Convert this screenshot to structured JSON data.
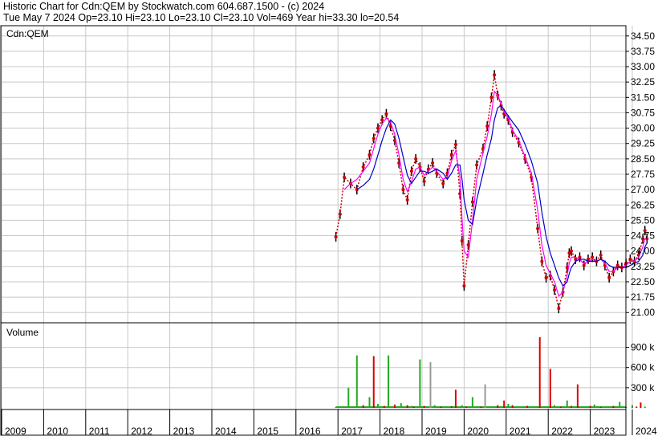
{
  "header": {
    "line1": "Historic Chart for Cdn:QEM by Stockwatch.com 604.687.1500 - (c) 2024",
    "line2": "Tue May  7 2024  Op=23.10  Hi=23.10  Lo=23.10  Cl=23.10  Vol=469  Year hi=33.30  lo=20.54"
  },
  "colors": {
    "grid": "#c8c8c8",
    "price": "#cc0000",
    "bar": "#000000",
    "ma_short": "#ff00ff",
    "ma_long": "#0000cc",
    "vol_up": "#22aa22",
    "vol_down": "#dd0000",
    "vol_flat": "#999999"
  },
  "chart_data": [
    {
      "type": "line",
      "title": "Cdn:QEM",
      "y_ticks": [
        "34.50",
        "33.75",
        "33.00",
        "32.25",
        "31.50",
        "30.75",
        "30.00",
        "29.25",
        "28.50",
        "27.75",
        "27.00",
        "26.25",
        "25.50",
        "24.75",
        "24.00",
        "23.25",
        "22.50",
        "21.75",
        "21.00"
      ],
      "ylim": [
        20.5,
        35.0
      ],
      "x_ticks": [
        "2009",
        "2010",
        "2011",
        "2012",
        "2013",
        "2014",
        "2015",
        "2016",
        "2017",
        "2018",
        "2019",
        "2020",
        "2021",
        "2022",
        "2023",
        "2024"
      ],
      "x": [
        2016.95,
        2017.05,
        2017.15,
        2017.3,
        2017.45,
        2017.6,
        2017.75,
        2017.85,
        2017.95,
        2018.05,
        2018.15,
        2018.25,
        2018.35,
        2018.45,
        2018.55,
        2018.65,
        2018.75,
        2018.85,
        2018.95,
        2019.05,
        2019.15,
        2019.25,
        2019.35,
        2019.5,
        2019.6,
        2019.7,
        2019.8,
        2019.9,
        2019.95,
        2020.0,
        2020.1,
        2020.2,
        2020.3,
        2020.45,
        2020.55,
        2020.65,
        2020.72,
        2020.8,
        2020.88,
        2020.95,
        2021.05,
        2021.15,
        2021.3,
        2021.45,
        2021.6,
        2021.75,
        2021.85,
        2021.95,
        2022.05,
        2022.15,
        2022.25,
        2022.35,
        2022.45,
        2022.5,
        2022.55,
        2022.65,
        2022.75,
        2022.85,
        2022.95,
        2023.05,
        2023.15,
        2023.25,
        2023.35,
        2023.45,
        2023.55,
        2023.65,
        2023.75,
        2023.85,
        2023.95,
        2024.05,
        2024.15,
        2024.25,
        2024.3,
        2024.35
      ],
      "series": [
        {
          "values": [
            24.7,
            25.8,
            27.6,
            27.3,
            27.0,
            28.1,
            28.7,
            29.5,
            30.0,
            30.4,
            30.7,
            30.1,
            29.4,
            28.3,
            27.0,
            26.5,
            27.9,
            28.5,
            28.1,
            27.4,
            28.0,
            28.3,
            27.8,
            27.3,
            27.8,
            28.7,
            29.2,
            26.8,
            24.5,
            22.3,
            24.3,
            26.4,
            28.2,
            29.0,
            30.1,
            31.5,
            32.6,
            31.6,
            31.1,
            30.7,
            30.4,
            29.8,
            29.3,
            28.5,
            27.6,
            25.1,
            23.5,
            22.7,
            22.8,
            22.1,
            21.2,
            22.0,
            23.2,
            23.9,
            24.0,
            23.6,
            23.7,
            23.3,
            23.6,
            23.7,
            23.5,
            23.8,
            23.3,
            22.7,
            23.0,
            23.3,
            23.2,
            23.4,
            23.6,
            23.5,
            23.8,
            24.6,
            25.0,
            24.6
          ]
        },
        {
          "values": [
            null,
            null,
            27.0,
            27.3,
            27.5,
            27.9,
            28.3,
            29.0,
            29.7,
            30.2,
            30.5,
            30.3,
            29.7,
            28.7,
            27.5,
            26.9,
            27.4,
            28.0,
            28.1,
            27.7,
            27.9,
            28.1,
            27.9,
            27.5,
            27.6,
            28.4,
            28.9,
            27.6,
            25.6,
            24.0,
            23.7,
            25.5,
            27.5,
            28.8,
            29.6,
            30.7,
            31.8,
            31.6,
            31.2,
            30.8,
            30.5,
            29.9,
            29.4,
            28.6,
            27.8,
            26.0,
            24.3,
            23.3,
            22.9,
            22.5,
            21.8,
            22.0,
            22.8,
            23.4,
            23.7,
            23.7,
            23.6,
            23.4,
            23.5,
            23.6,
            23.5,
            23.6,
            23.4,
            23.0,
            23.0,
            23.2,
            23.2,
            23.3,
            23.5,
            23.5,
            23.7,
            24.2,
            24.6,
            24.6
          ]
        },
        {
          "values": [
            null,
            null,
            null,
            null,
            27.0,
            27.2,
            27.5,
            28.0,
            28.7,
            29.4,
            30.0,
            30.4,
            30.2,
            29.5,
            28.6,
            27.7,
            27.3,
            27.6,
            27.9,
            27.9,
            27.8,
            27.9,
            28.0,
            27.8,
            27.5,
            27.8,
            28.2,
            28.2,
            27.5,
            26.5,
            25.5,
            25.3,
            26.5,
            27.8,
            28.7,
            29.5,
            30.4,
            31.0,
            31.1,
            30.9,
            30.6,
            30.3,
            29.9,
            29.2,
            28.4,
            27.3,
            25.9,
            24.7,
            23.9,
            23.3,
            22.7,
            22.3,
            22.5,
            22.9,
            23.2,
            23.5,
            23.6,
            23.6,
            23.5,
            23.5,
            23.5,
            23.6,
            23.5,
            23.3,
            23.2,
            23.2,
            23.2,
            23.2,
            23.3,
            23.4,
            23.5,
            23.8,
            24.2,
            24.4
          ]
        }
      ]
    },
    {
      "type": "bar",
      "title": "Volume",
      "y_ticks": [
        "900 k",
        "600 k",
        "300 k"
      ],
      "ylim": [
        0,
        1050
      ],
      "x": [
        2016.95,
        2017.25,
        2017.45,
        2017.6,
        2017.75,
        2017.85,
        2017.95,
        2018.1,
        2018.2,
        2018.35,
        2018.5,
        2018.65,
        2018.75,
        2018.8,
        2018.95,
        2019.05,
        2019.2,
        2019.3,
        2019.45,
        2019.55,
        2019.7,
        2019.8,
        2019.95,
        2020.05,
        2020.2,
        2020.4,
        2020.5,
        2020.65,
        2020.8,
        2020.95,
        2021.05,
        2021.15,
        2021.3,
        2021.5,
        2021.65,
        2021.8,
        2021.95,
        2022.05,
        2022.15,
        2022.3,
        2022.45,
        2022.55,
        2022.7,
        2022.85,
        2023.0,
        2023.1,
        2023.25,
        2023.4,
        2023.55,
        2023.7,
        2023.85,
        2024.0,
        2024.1,
        2024.2,
        2024.3
      ],
      "values": [
        15,
        300,
        780,
        40,
        160,
        770,
        60,
        30,
        780,
        50,
        70,
        40,
        30,
        20,
        720,
        30,
        680,
        40,
        20,
        10,
        25,
        270,
        40,
        20,
        160,
        20,
        350,
        20,
        40,
        110,
        60,
        40,
        20,
        30,
        15,
        1050,
        20,
        580,
        40,
        20,
        110,
        30,
        350,
        20,
        30,
        50,
        15,
        20,
        30,
        90,
        10,
        40,
        20,
        80,
        20
      ],
      "colors": [
        "vol_up",
        "vol_up",
        "vol_up",
        "vol_down",
        "vol_up",
        "vol_down",
        "vol_up",
        "vol_down",
        "vol_up",
        "vol_down",
        "vol_up",
        "vol_down",
        "vol_up",
        "vol_down",
        "vol_up",
        "vol_down",
        "vol_flat",
        "vol_up",
        "vol_down",
        "vol_up",
        "vol_down",
        "vol_down",
        "vol_up",
        "vol_down",
        "vol_up",
        "vol_down",
        "vol_flat",
        "vol_up",
        "vol_down",
        "vol_down",
        "vol_up",
        "vol_down",
        "vol_up",
        "vol_down",
        "vol_up",
        "vol_down",
        "vol_up",
        "vol_down",
        "vol_up",
        "vol_down",
        "vol_up",
        "vol_down",
        "vol_down",
        "vol_up",
        "vol_down",
        "vol_up",
        "vol_down",
        "vol_up",
        "vol_down",
        "vol_up",
        "vol_down",
        "vol_up",
        "vol_down",
        "vol_down",
        "vol_up"
      ]
    }
  ]
}
